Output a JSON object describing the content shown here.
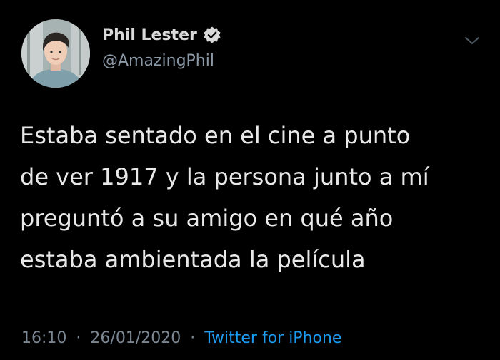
{
  "user": {
    "display_name": "Phil Lester",
    "handle": "@AmazingPhil",
    "verified": true
  },
  "tweet": {
    "lines": [
      "Estaba sentado en el cine a punto",
      "de ver 1917 y la persona junto a mí",
      "preguntó a su amigo en qué año",
      "estaba ambientada la película"
    ],
    "time": "16:10",
    "separator": "·",
    "date": "26/01/2020",
    "source": "Twitter for iPhone"
  },
  "icons": {
    "verified": "verified-badge-icon",
    "menu": "chevron-down-icon"
  },
  "colors": {
    "background": "#000000",
    "text": "#e8e8e8",
    "muted": "#7b8793",
    "link": "#1c9bf0"
  }
}
